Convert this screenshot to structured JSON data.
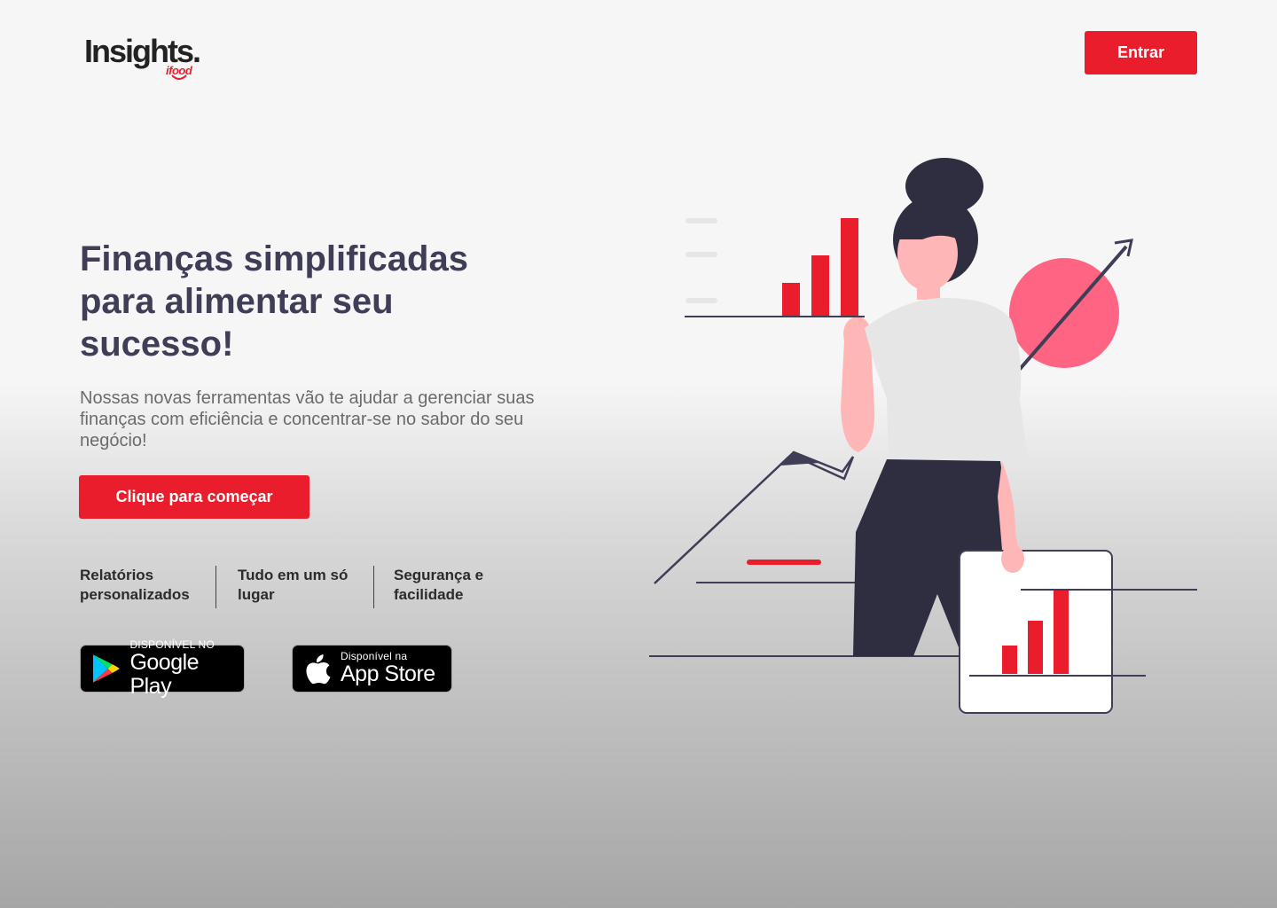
{
  "header": {
    "logo_text": "Insights.",
    "logo_sub": "ifood",
    "login_label": "Entrar"
  },
  "hero": {
    "title_line1": "Finanças simplificadas",
    "title_line2": "para alimentar seu",
    "title_line3": "sucesso!",
    "description": "Nossas novas ferramentas vão te ajudar a gerenciar suas finanças com eficiência e concentrar-se no sabor do seu negócio!",
    "cta_label": "Clique para começar"
  },
  "features": [
    {
      "line1": "Relatórios",
      "line2": "personalizados"
    },
    {
      "line1": "Tudo em um só",
      "line2": "lugar"
    },
    {
      "line1": "Segurança e",
      "line2": "facilidade"
    }
  ],
  "stores": {
    "google": {
      "small": "DISPONÍVEL NO",
      "big": "Google Play",
      "icon": "google-play-icon"
    },
    "apple": {
      "small": "Disponível na",
      "big": "App Store",
      "icon": "apple-icon"
    }
  },
  "colors": {
    "brand_red": "#ea1d2c",
    "dark": "#3f3e56",
    "pink_circle": "#ff6582"
  }
}
